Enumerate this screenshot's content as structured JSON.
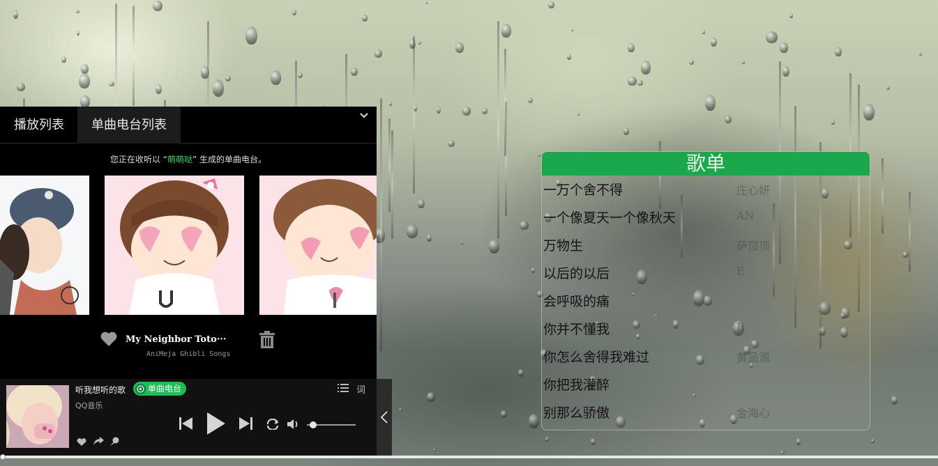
{
  "playlist_panel": {
    "title": "歌单",
    "songs": [
      {
        "title": "一万个舍不得",
        "artist": "庄心妍"
      },
      {
        "title": "一个像夏天一个像秋天",
        "artist": "AN"
      },
      {
        "title": "万物生",
        "artist": "萨顶顶"
      },
      {
        "title": "以后的以后",
        "artist": "E"
      },
      {
        "title": "会呼吸的痛",
        "artist": ""
      },
      {
        "title": "你并不懂我",
        "artist": "B"
      },
      {
        "title": "你怎么舍得我难过",
        "artist": "黄品源"
      },
      {
        "title": "你把我灌醉",
        "artist": ""
      },
      {
        "title": "别那么骄傲",
        "artist": "金海心"
      }
    ]
  },
  "player": {
    "tabs": [
      {
        "label": "播放列表",
        "active": false
      },
      {
        "label": "单曲电台列表",
        "active": true
      }
    ],
    "notice": {
      "prefix": "您正在收听以 “",
      "highlight": "萌萌哒",
      "suffix": "” 生成的单曲电台。"
    },
    "current_track": {
      "title": "My Neighbor Toto···",
      "album": "AniMeja Ghibli Songs"
    }
  },
  "bottom_bar": {
    "title": "听我想听的歌",
    "radio_badge": "单曲电台",
    "subtitle": "QQ音乐",
    "lyrics_label": "词",
    "volume_level": 0.1,
    "progress": 0.0
  },
  "colors": {
    "accent_green": "#1ba84a",
    "badge_green": "#1bbf55"
  }
}
